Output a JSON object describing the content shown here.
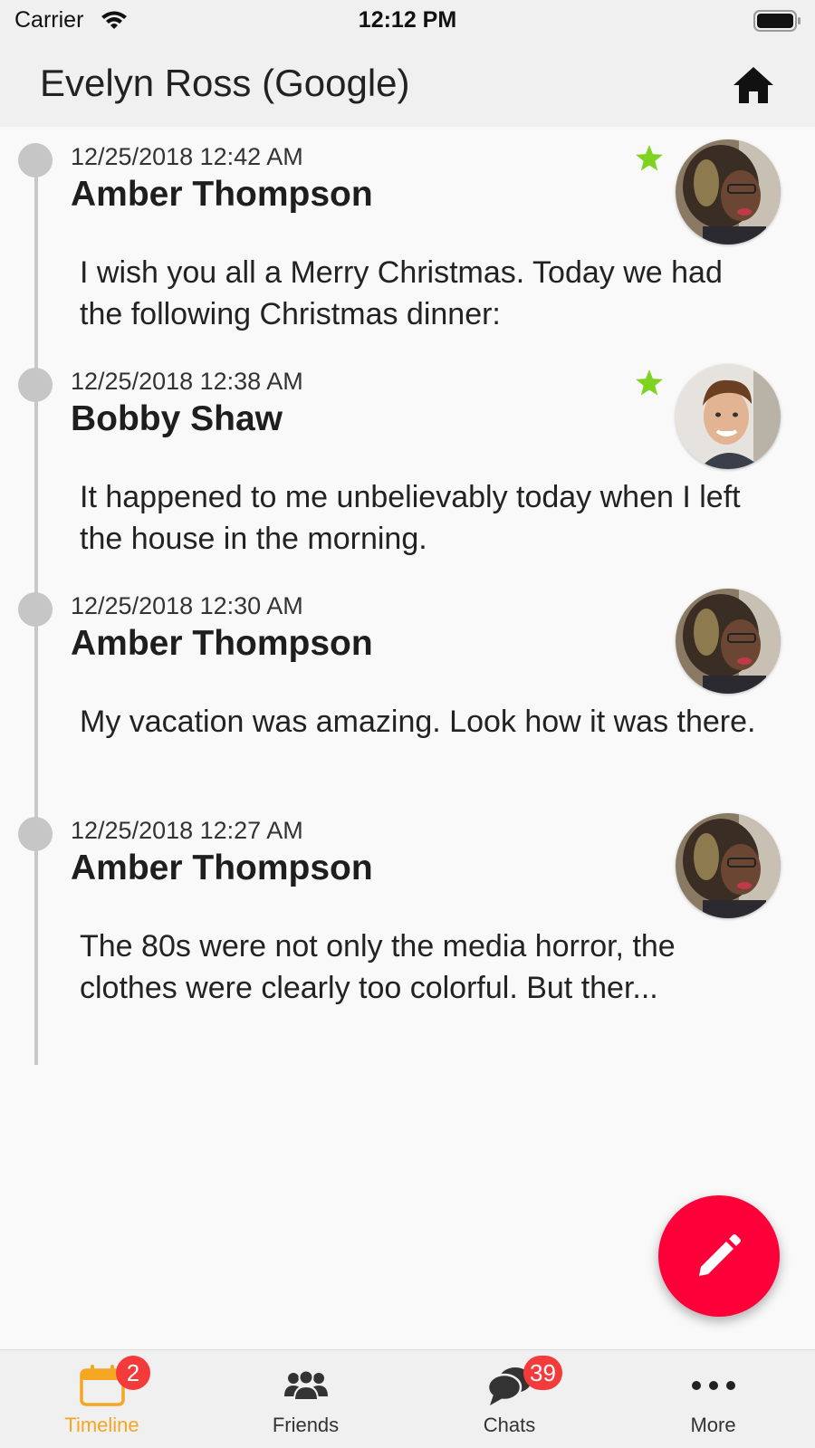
{
  "status_bar": {
    "carrier": "Carrier",
    "time": "12:12 PM"
  },
  "nav": {
    "title": "Evelyn Ross (Google)",
    "right_icon": "home-icon"
  },
  "timeline": {
    "posts": [
      {
        "date": "12/25/2018 12:42 AM",
        "author": "Amber Thompson",
        "text": "I wish you all a Merry Christmas. Today we had the following Christmas dinner:",
        "starred": true,
        "avatar": "amber-thompson"
      },
      {
        "date": "12/25/2018 12:38 AM",
        "author": "Bobby Shaw",
        "text": "It happened to me unbelievably today when I left the house in the morning.",
        "starred": true,
        "avatar": "bobby-shaw"
      },
      {
        "date": "12/25/2018 12:30 AM",
        "author": "Amber Thompson",
        "text": "My vacation was amazing. Look how it was there.",
        "starred": false,
        "avatar": "amber-thompson"
      },
      {
        "date": "12/25/2018 12:27 AM",
        "author": "Amber Thompson",
        "text": "The 80s were not only the media horror, the clothes were clearly too colorful. But ther...",
        "starred": false,
        "avatar": "amber-thompson"
      }
    ]
  },
  "fab": {
    "icon": "pencil-icon",
    "color": "#fe0039"
  },
  "tab_bar": {
    "tabs": [
      {
        "label": "Timeline",
        "icon": "calendar-icon",
        "badge": "2",
        "active": true
      },
      {
        "label": "Friends",
        "icon": "people-icon",
        "badge": "",
        "active": false
      },
      {
        "label": "Chats",
        "icon": "chat-bubbles-icon",
        "badge": "39",
        "active": false
      },
      {
        "label": "More",
        "icon": "more-dots-icon",
        "badge": "",
        "active": false
      }
    ]
  },
  "colors": {
    "accent": "#f5a623",
    "badge": "#f43a3a",
    "star": "#7ed321",
    "timeline": "#c8c8c8"
  }
}
